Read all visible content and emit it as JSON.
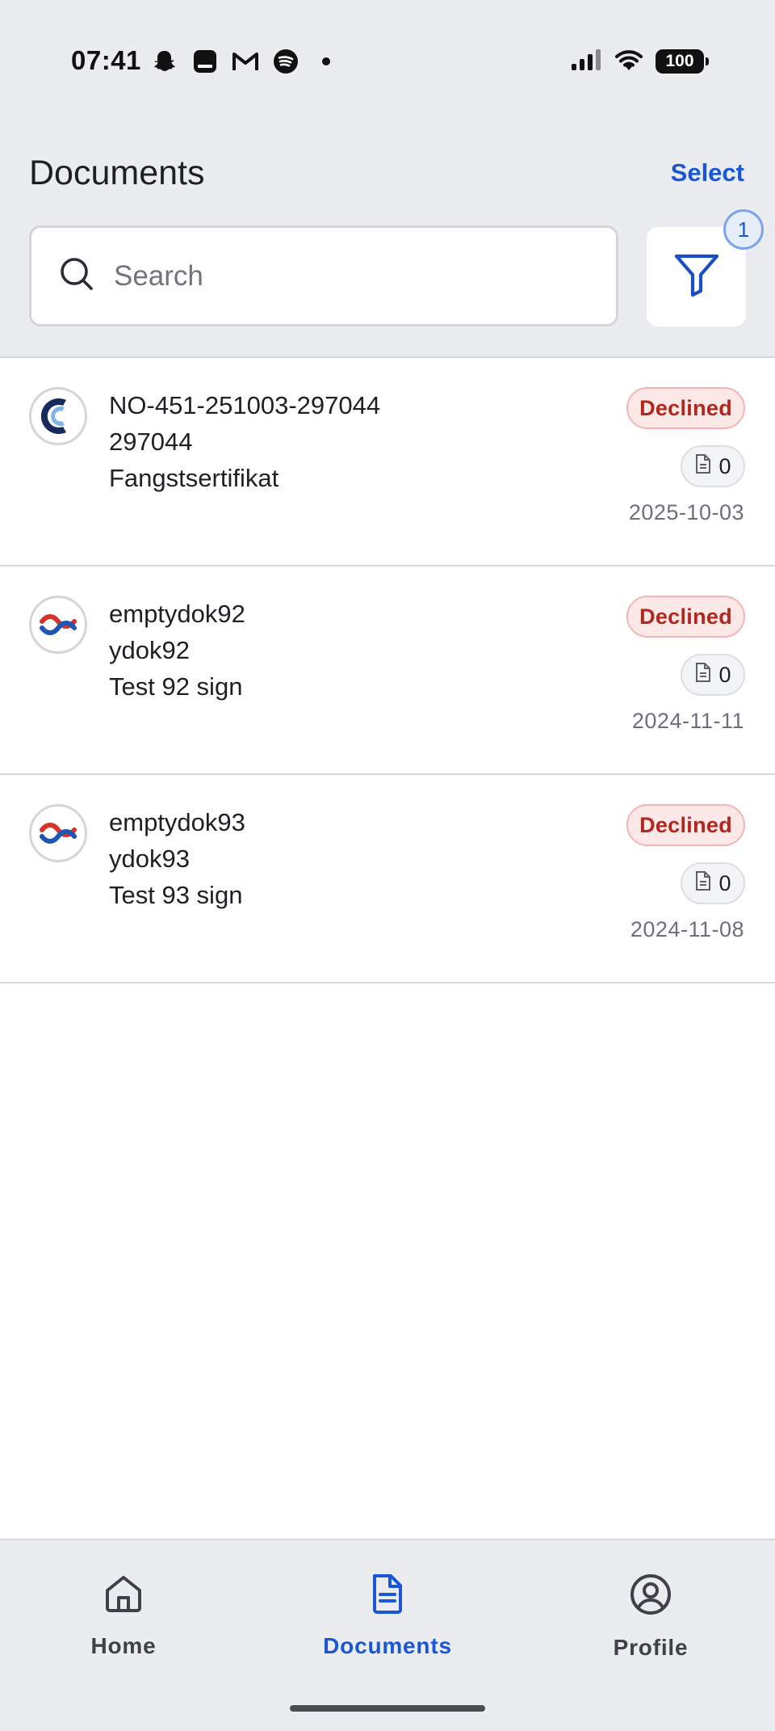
{
  "status_bar": {
    "time": "07:41",
    "left_icons": [
      "snapchat-icon",
      "app-icon",
      "gmail-icon",
      "spotify-icon",
      "dot-icon"
    ],
    "battery": "100"
  },
  "header": {
    "title": "Documents",
    "select_label": "Select"
  },
  "search": {
    "placeholder": "Search",
    "value": ""
  },
  "filter": {
    "badge_count": "1"
  },
  "documents": [
    {
      "logo": "blue-c-logo",
      "line1": "NO-451-251003-297044",
      "line2": "297044",
      "line3": "Fangstsertifikat",
      "status": "Declined",
      "attachments": "0",
      "date": "2025-10-03"
    },
    {
      "logo": "red-blue-chain-logo",
      "line1": "emptydok92",
      "line2": "ydok92",
      "line3": "Test 92 sign",
      "status": "Declined",
      "attachments": "0",
      "date": "2024-11-11"
    },
    {
      "logo": "red-blue-chain-logo",
      "line1": "emptydok93",
      "line2": "ydok93",
      "line3": "Test 93 sign",
      "status": "Declined",
      "attachments": "0",
      "date": "2024-11-08"
    }
  ],
  "nav": {
    "home": "Home",
    "documents": "Documents",
    "profile": "Profile"
  },
  "colors": {
    "accent": "#1957d6",
    "declined_text": "#b3261e",
    "declined_bg": "#fde8e8",
    "background_gray": "#ebecf0"
  }
}
